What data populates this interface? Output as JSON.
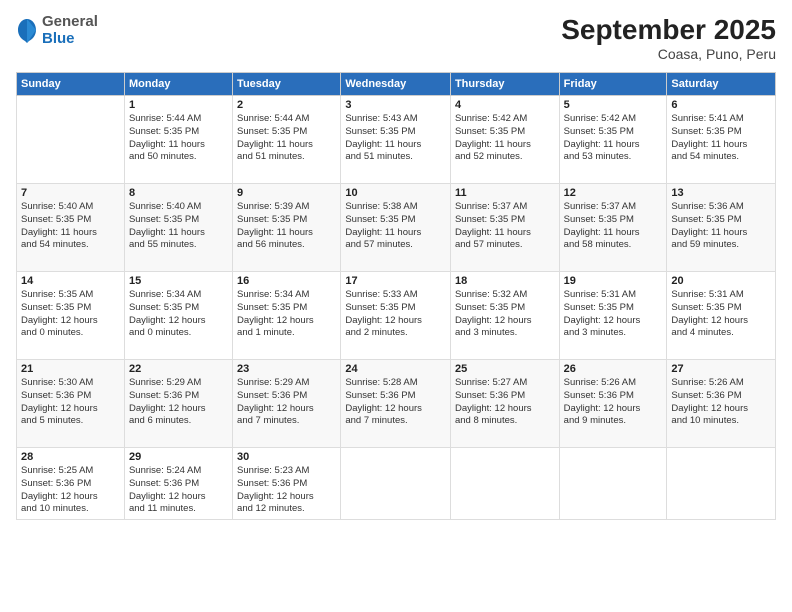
{
  "header": {
    "logo_general": "General",
    "logo_blue": "Blue",
    "month_title": "September 2025",
    "subtitle": "Coasa, Puno, Peru"
  },
  "weekdays": [
    "Sunday",
    "Monday",
    "Tuesday",
    "Wednesday",
    "Thursday",
    "Friday",
    "Saturday"
  ],
  "weeks": [
    [
      {
        "day": "",
        "info": ""
      },
      {
        "day": "1",
        "info": "Sunrise: 5:44 AM\nSunset: 5:35 PM\nDaylight: 11 hours\nand 50 minutes."
      },
      {
        "day": "2",
        "info": "Sunrise: 5:44 AM\nSunset: 5:35 PM\nDaylight: 11 hours\nand 51 minutes."
      },
      {
        "day": "3",
        "info": "Sunrise: 5:43 AM\nSunset: 5:35 PM\nDaylight: 11 hours\nand 51 minutes."
      },
      {
        "day": "4",
        "info": "Sunrise: 5:42 AM\nSunset: 5:35 PM\nDaylight: 11 hours\nand 52 minutes."
      },
      {
        "day": "5",
        "info": "Sunrise: 5:42 AM\nSunset: 5:35 PM\nDaylight: 11 hours\nand 53 minutes."
      },
      {
        "day": "6",
        "info": "Sunrise: 5:41 AM\nSunset: 5:35 PM\nDaylight: 11 hours\nand 54 minutes."
      }
    ],
    [
      {
        "day": "7",
        "info": "Sunrise: 5:40 AM\nSunset: 5:35 PM\nDaylight: 11 hours\nand 54 minutes."
      },
      {
        "day": "8",
        "info": "Sunrise: 5:40 AM\nSunset: 5:35 PM\nDaylight: 11 hours\nand 55 minutes."
      },
      {
        "day": "9",
        "info": "Sunrise: 5:39 AM\nSunset: 5:35 PM\nDaylight: 11 hours\nand 56 minutes."
      },
      {
        "day": "10",
        "info": "Sunrise: 5:38 AM\nSunset: 5:35 PM\nDaylight: 11 hours\nand 57 minutes."
      },
      {
        "day": "11",
        "info": "Sunrise: 5:37 AM\nSunset: 5:35 PM\nDaylight: 11 hours\nand 57 minutes."
      },
      {
        "day": "12",
        "info": "Sunrise: 5:37 AM\nSunset: 5:35 PM\nDaylight: 11 hours\nand 58 minutes."
      },
      {
        "day": "13",
        "info": "Sunrise: 5:36 AM\nSunset: 5:35 PM\nDaylight: 11 hours\nand 59 minutes."
      }
    ],
    [
      {
        "day": "14",
        "info": "Sunrise: 5:35 AM\nSunset: 5:35 PM\nDaylight: 12 hours\nand 0 minutes."
      },
      {
        "day": "15",
        "info": "Sunrise: 5:34 AM\nSunset: 5:35 PM\nDaylight: 12 hours\nand 0 minutes."
      },
      {
        "day": "16",
        "info": "Sunrise: 5:34 AM\nSunset: 5:35 PM\nDaylight: 12 hours\nand 1 minute."
      },
      {
        "day": "17",
        "info": "Sunrise: 5:33 AM\nSunset: 5:35 PM\nDaylight: 12 hours\nand 2 minutes."
      },
      {
        "day": "18",
        "info": "Sunrise: 5:32 AM\nSunset: 5:35 PM\nDaylight: 12 hours\nand 3 minutes."
      },
      {
        "day": "19",
        "info": "Sunrise: 5:31 AM\nSunset: 5:35 PM\nDaylight: 12 hours\nand 3 minutes."
      },
      {
        "day": "20",
        "info": "Sunrise: 5:31 AM\nSunset: 5:35 PM\nDaylight: 12 hours\nand 4 minutes."
      }
    ],
    [
      {
        "day": "21",
        "info": "Sunrise: 5:30 AM\nSunset: 5:36 PM\nDaylight: 12 hours\nand 5 minutes."
      },
      {
        "day": "22",
        "info": "Sunrise: 5:29 AM\nSunset: 5:36 PM\nDaylight: 12 hours\nand 6 minutes."
      },
      {
        "day": "23",
        "info": "Sunrise: 5:29 AM\nSunset: 5:36 PM\nDaylight: 12 hours\nand 7 minutes."
      },
      {
        "day": "24",
        "info": "Sunrise: 5:28 AM\nSunset: 5:36 PM\nDaylight: 12 hours\nand 7 minutes."
      },
      {
        "day": "25",
        "info": "Sunrise: 5:27 AM\nSunset: 5:36 PM\nDaylight: 12 hours\nand 8 minutes."
      },
      {
        "day": "26",
        "info": "Sunrise: 5:26 AM\nSunset: 5:36 PM\nDaylight: 12 hours\nand 9 minutes."
      },
      {
        "day": "27",
        "info": "Sunrise: 5:26 AM\nSunset: 5:36 PM\nDaylight: 12 hours\nand 10 minutes."
      }
    ],
    [
      {
        "day": "28",
        "info": "Sunrise: 5:25 AM\nSunset: 5:36 PM\nDaylight: 12 hours\nand 10 minutes."
      },
      {
        "day": "29",
        "info": "Sunrise: 5:24 AM\nSunset: 5:36 PM\nDaylight: 12 hours\nand 11 minutes."
      },
      {
        "day": "30",
        "info": "Sunrise: 5:23 AM\nSunset: 5:36 PM\nDaylight: 12 hours\nand 12 minutes."
      },
      {
        "day": "",
        "info": ""
      },
      {
        "day": "",
        "info": ""
      },
      {
        "day": "",
        "info": ""
      },
      {
        "day": "",
        "info": ""
      }
    ]
  ]
}
